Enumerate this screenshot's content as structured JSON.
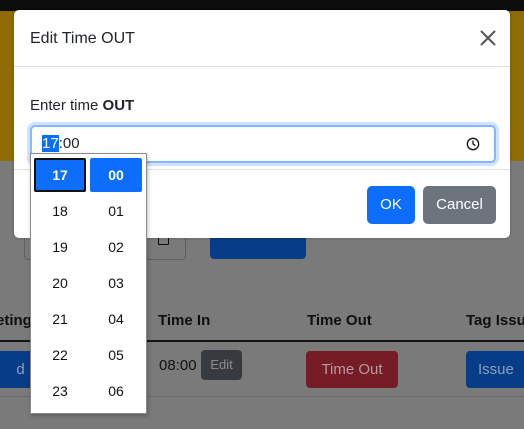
{
  "background": {
    "table_headers": [
      "eting",
      "Time In",
      "Time Out",
      "Tag Issu"
    ],
    "row": {
      "action_button": "d Ro",
      "time_in": "08:00",
      "edit_button": "Edit",
      "time_out_button": "Time Out",
      "issue_button": "Issue"
    }
  },
  "modal": {
    "title": "Edit Time OUT",
    "prompt_prefix": "Enter time ",
    "prompt_bold": "OUT",
    "time_hours": "17",
    "time_sep": ":",
    "time_minutes": "00",
    "ok_label": "OK",
    "cancel_label": "Cancel"
  },
  "picker": {
    "hours": [
      "17",
      "18",
      "19",
      "20",
      "21",
      "22",
      "23"
    ],
    "minutes": [
      "00",
      "01",
      "02",
      "03",
      "04",
      "05",
      "06"
    ],
    "selected_hour": "17",
    "selected_minute": "00"
  },
  "icons": {
    "close": "close-icon",
    "clock": "clock-icon",
    "calendar": "calendar-icon"
  },
  "colors": {
    "primary": "#0d6efd",
    "secondary": "#6c757d",
    "danger": "#dc3545",
    "brand_yellow": "#f6b80b"
  }
}
